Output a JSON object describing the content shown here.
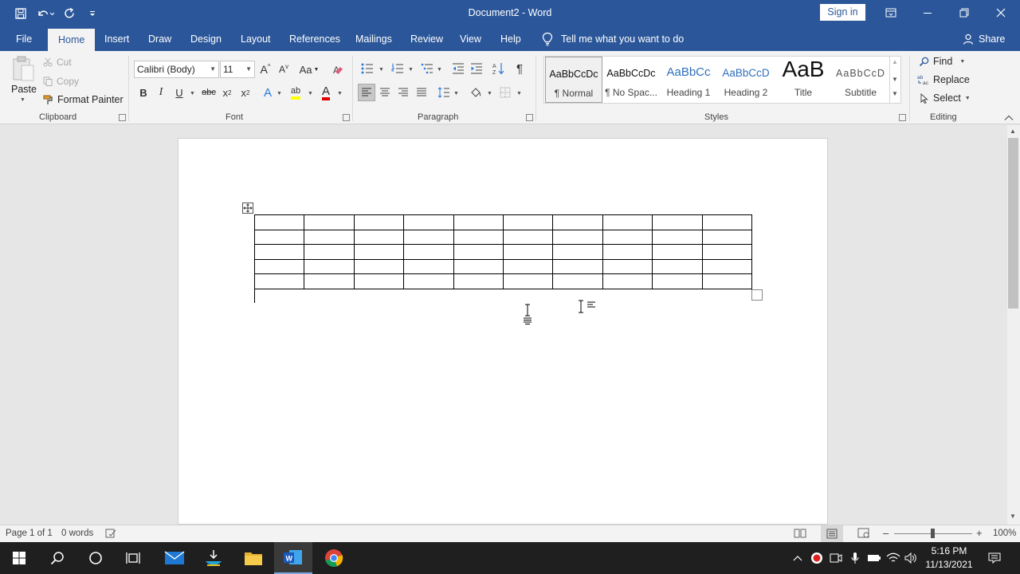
{
  "window": {
    "title": "Document2  -  Word",
    "sign_in": "Sign in"
  },
  "tabs": [
    "File",
    "Home",
    "Insert",
    "Draw",
    "Design",
    "Layout",
    "References",
    "Mailings",
    "Review",
    "View",
    "Help"
  ],
  "tell_me": "Tell me what you want to do",
  "share": "Share",
  "clipboard": {
    "paste": "Paste",
    "cut": "Cut",
    "copy": "Copy",
    "format_painter": "Format Painter",
    "group": "Clipboard"
  },
  "font": {
    "family": "Calibri (Body)",
    "size": "11",
    "group": "Font",
    "bold": "B",
    "italic": "I",
    "underline": "U",
    "strike": "abc",
    "subscript": "x",
    "superscript": "x",
    "grow": "A",
    "shrink": "A",
    "change_case": "Aa",
    "font_color_letter": "A",
    "highlight_letter": "ab",
    "effects_letter": "A"
  },
  "paragraph": {
    "group": "Paragraph"
  },
  "styles": {
    "group": "Styles",
    "items": [
      {
        "preview": "AaBbCcDc",
        "name": "¶ Normal"
      },
      {
        "preview": "AaBbCcDc",
        "name": "¶ No Spac..."
      },
      {
        "preview": "AaBbCc",
        "name": "Heading 1"
      },
      {
        "preview": "AaBbCcD",
        "name": "Heading 2"
      },
      {
        "preview": "AaB",
        "name": "Title"
      },
      {
        "preview": "AaBbCcD",
        "name": "Subtitle"
      }
    ]
  },
  "editing": {
    "group": "Editing",
    "find": "Find",
    "replace": "Replace",
    "select": "Select"
  },
  "document": {
    "table": {
      "rows": 5,
      "cols": 10
    }
  },
  "status": {
    "page": "Page 1 of 1",
    "words": "0 words",
    "zoom": "100%"
  },
  "clock": {
    "time": "5:16 PM",
    "date": "11/13/2021"
  },
  "colors": {
    "word_blue": "#2b579a",
    "ribbon_bg": "#f3f3f3",
    "canvas_bg": "#e6e6e6",
    "taskbar": "#1f1f1f"
  }
}
